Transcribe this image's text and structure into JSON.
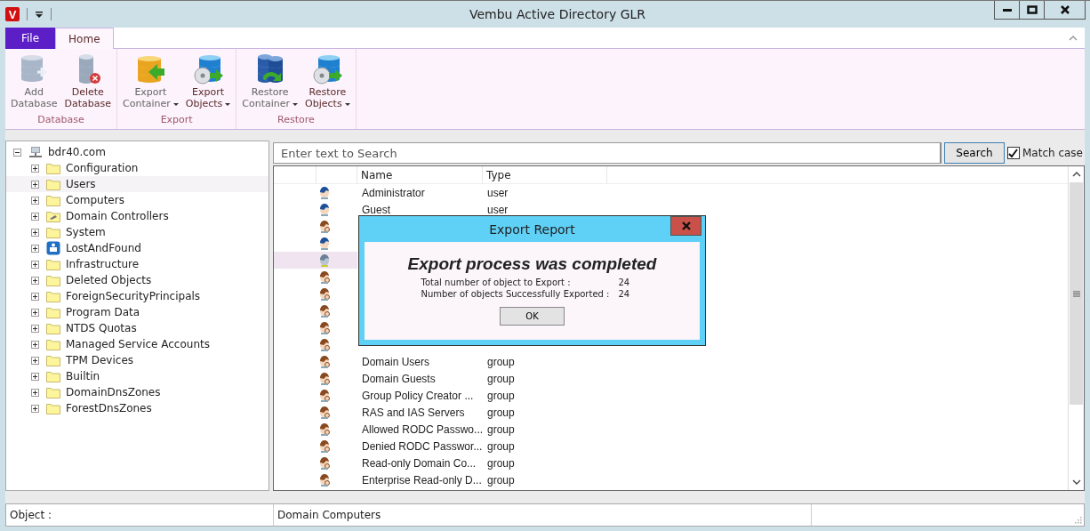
{
  "window": {
    "title": "Vembu Active Directory GLR",
    "app_letter": "V"
  },
  "ribbon": {
    "tabs": [
      {
        "label": "File",
        "kind": "file",
        "selected": false
      },
      {
        "label": "Home",
        "kind": "tab",
        "selected": true
      }
    ],
    "groups": [
      {
        "label": "Database",
        "buttons": [
          {
            "kind": "add",
            "lines": [
              "Add",
              "Database"
            ],
            "dropdown": false
          },
          {
            "kind": "delete",
            "lines": [
              "Delete",
              "Database"
            ],
            "dropdown": false
          }
        ]
      },
      {
        "label": "Export",
        "buttons": [
          {
            "kind": "container",
            "lines": [
              "Export",
              "Container"
            ],
            "dropdown": true
          },
          {
            "kind": "objects",
            "lines": [
              "Export",
              "Objects"
            ],
            "dropdown": true
          }
        ]
      },
      {
        "label": "Restore",
        "buttons": [
          {
            "kind": "restore",
            "lines": [
              "Restore",
              "Container"
            ],
            "dropdown": true
          },
          {
            "kind": "objects",
            "lines": [
              "Restore",
              "Objects"
            ],
            "dropdown": true
          }
        ]
      }
    ]
  },
  "tree": {
    "label": "bdr40.com",
    "expanded": true,
    "children": [
      {
        "label": "Configuration",
        "kind": "folder",
        "selected": false
      },
      {
        "label": "Users",
        "kind": "folder",
        "selected": true
      },
      {
        "label": "Computers",
        "kind": "folder",
        "selected": false
      },
      {
        "label": "Domain Controllers",
        "kind": "dc",
        "selected": false
      },
      {
        "label": "System",
        "kind": "folder",
        "selected": false
      },
      {
        "label": "LostAndFound",
        "kind": "lost",
        "selected": false
      },
      {
        "label": "Infrastructure",
        "kind": "folder",
        "selected": false
      },
      {
        "label": "Deleted Objects",
        "kind": "folder",
        "selected": false
      },
      {
        "label": "ForeignSecurityPrincipals",
        "kind": "folder",
        "selected": false
      },
      {
        "label": "Program Data",
        "kind": "folder",
        "selected": false
      },
      {
        "label": "NTDS Quotas",
        "kind": "folder",
        "selected": false
      },
      {
        "label": "Managed Service Accounts",
        "kind": "folder",
        "selected": false
      },
      {
        "label": "TPM Devices",
        "kind": "folder",
        "selected": false
      },
      {
        "label": "Builtin",
        "kind": "folder",
        "selected": false
      },
      {
        "label": "DomainDnsZones",
        "kind": "folder",
        "selected": false
      },
      {
        "label": "ForestDnsZones",
        "kind": "folder",
        "selected": false
      }
    ]
  },
  "search": {
    "placeholder": "Enter text to Search",
    "button": "Search",
    "match_case": {
      "label": "Match case",
      "checked": true
    }
  },
  "table": {
    "columns": [
      "Name",
      "Type"
    ],
    "rows": [
      {
        "kind": "user",
        "name": "Administrator",
        "type": "user",
        "selected": false
      },
      {
        "kind": "user",
        "name": "Guest",
        "type": "user",
        "selected": false
      },
      {
        "kind": "group",
        "selected": false
      },
      {
        "kind": "user",
        "selected": false
      },
      {
        "kind": "computer",
        "selected": true
      },
      {
        "kind": "group",
        "selected": false
      },
      {
        "kind": "group",
        "selected": false
      },
      {
        "kind": "group",
        "selected": false
      },
      {
        "kind": "group",
        "selected": false
      },
      {
        "kind": "group",
        "selected": false
      },
      {
        "kind": "group",
        "name": "Domain Users",
        "type": "group",
        "selected": false
      },
      {
        "kind": "group",
        "name": "Domain Guests",
        "type": "group",
        "selected": false
      },
      {
        "kind": "group",
        "name": "Group Policy Creator ...",
        "type": "group",
        "selected": false
      },
      {
        "kind": "group",
        "name": "RAS and IAS Servers",
        "type": "group",
        "selected": false
      },
      {
        "kind": "group",
        "name": "Allowed RODC Passwo...",
        "type": "group",
        "selected": false
      },
      {
        "kind": "group",
        "name": "Denied RODC Passwor...",
        "type": "group",
        "selected": false
      },
      {
        "kind": "group",
        "name": "Read-only Domain Co...",
        "type": "group",
        "selected": false
      },
      {
        "kind": "group",
        "name": "Enterprise Read-only D...",
        "type": "group",
        "selected": false
      }
    ]
  },
  "dialog": {
    "title": "Export Report",
    "heading": "Export process was completed",
    "stats": [
      {
        "label": "Total number of object to Export :",
        "value": "24"
      },
      {
        "label": "Number of objects Successfully Exported :",
        "value": "24"
      }
    ],
    "button": "OK"
  },
  "status_bar": {
    "label": "Object :",
    "value": "Domain Computers"
  }
}
